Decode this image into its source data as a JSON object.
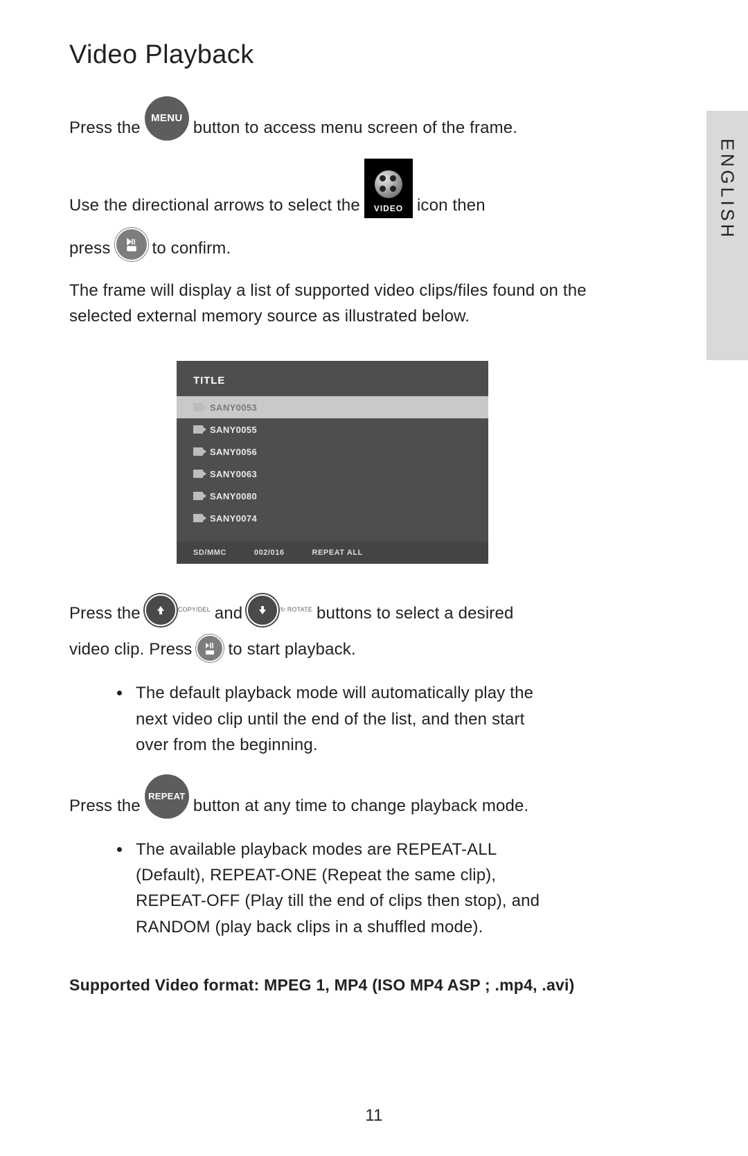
{
  "side_tab": "ENGLISH",
  "title": "Video Playback",
  "p1": {
    "a": "Press the",
    "b": "button to access menu screen of the frame."
  },
  "p2": {
    "a": "Use the directional arrows to select the",
    "b": "icon then"
  },
  "p3": {
    "a": "press",
    "b": "to confirm."
  },
  "p4": "The frame will display a list of supported video clips/files found on the selected external memory source as illustrated below.",
  "menu_label": "MENU",
  "video_tile_label": "VIDEO",
  "filelist": {
    "header": "TITLE",
    "selected": "SANY0053",
    "items": [
      "SANY0055",
      "SANY0056",
      "SANY0063",
      "SANY0080",
      "SANY0074"
    ],
    "footer": {
      "src": "SD/MMC",
      "count": "002/016",
      "mode": "REPEAT  ALL"
    }
  },
  "up_sub": "COPY/DEL",
  "down_sub": "ROTATE",
  "p5": {
    "a": "Press the",
    "b": "and",
    "c": "buttons to select a desired"
  },
  "p6": {
    "a": "video clip. Press",
    "b": "to start playback."
  },
  "bullet1": "The default playback mode will automatically play the next video clip until the end of the list, and then start over from the beginning.",
  "repeat_label": "REPEAT",
  "p7": {
    "a": "Press the",
    "b": "button at any time to change playback mode."
  },
  "bullet2": "The available playback modes are REPEAT-ALL (Default), REPEAT-ONE (Repeat the same clip), REPEAT-OFF (Play till the end of clips then stop), and RANDOM (play back clips in a shuffled mode).",
  "supported": "Supported Video format:  MPEG 1, MP4 (ISO MP4 ASP ; .mp4, .avi)",
  "page_number": "11"
}
